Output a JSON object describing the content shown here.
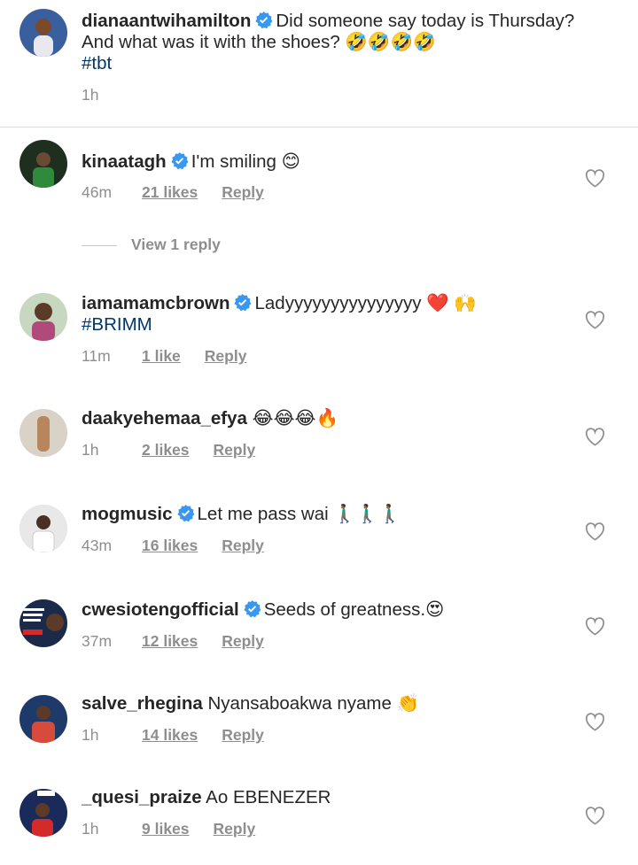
{
  "caption": {
    "username": "dianaantwihamilton",
    "text": "Did someone say today is Thursday? And what was it with the shoes? 🤣🤣🤣🤣",
    "hashtag": "#tbt",
    "time": "1h"
  },
  "view_replies_label": "View 1 reply",
  "comments": [
    {
      "username": "kinaatagh",
      "verified": true,
      "text": "I'm smiling 😊",
      "time": "46m",
      "likes": "21 likes",
      "reply": "Reply"
    },
    {
      "username": "iamamamcbrown",
      "verified": true,
      "text": "Ladyyyyyyyyyyyyyyy ❤️ 🙌",
      "hashtag": "#BRIMM",
      "time": "11m",
      "likes": "1 like",
      "reply": "Reply"
    },
    {
      "username": "daakyehemaa_efya",
      "verified": false,
      "text": "😂😂😂🔥",
      "time": "1h",
      "likes": "2 likes",
      "reply": "Reply"
    },
    {
      "username": "mogmusic",
      "verified": true,
      "text": "Let me pass wai 🚶🏾‍♂️🚶🏾‍♂️🚶🏾‍♂️",
      "time": "43m",
      "likes": "16 likes",
      "reply": "Reply"
    },
    {
      "username": "cwesiotengofficial",
      "verified": true,
      "text": "Seeds of greatness.😍",
      "time": "37m",
      "likes": "12 likes",
      "reply": "Reply"
    },
    {
      "username": "salve_rhegina",
      "verified": false,
      "text": "Nyansaboakwa nyame 👏",
      "time": "1h",
      "likes": "14 likes",
      "reply": "Reply"
    },
    {
      "username": "_quesi_praize",
      "verified": false,
      "text": "Ao EBENEZER",
      "time": "1h",
      "likes": "9 likes",
      "reply": "Reply"
    }
  ],
  "icons": {
    "verified": "verified-badge-icon",
    "like": "heart-outline-icon"
  },
  "colors": {
    "verified_blue": "#3897f0",
    "hashtag": "#00376b",
    "meta_gray": "#8e8e8e"
  }
}
